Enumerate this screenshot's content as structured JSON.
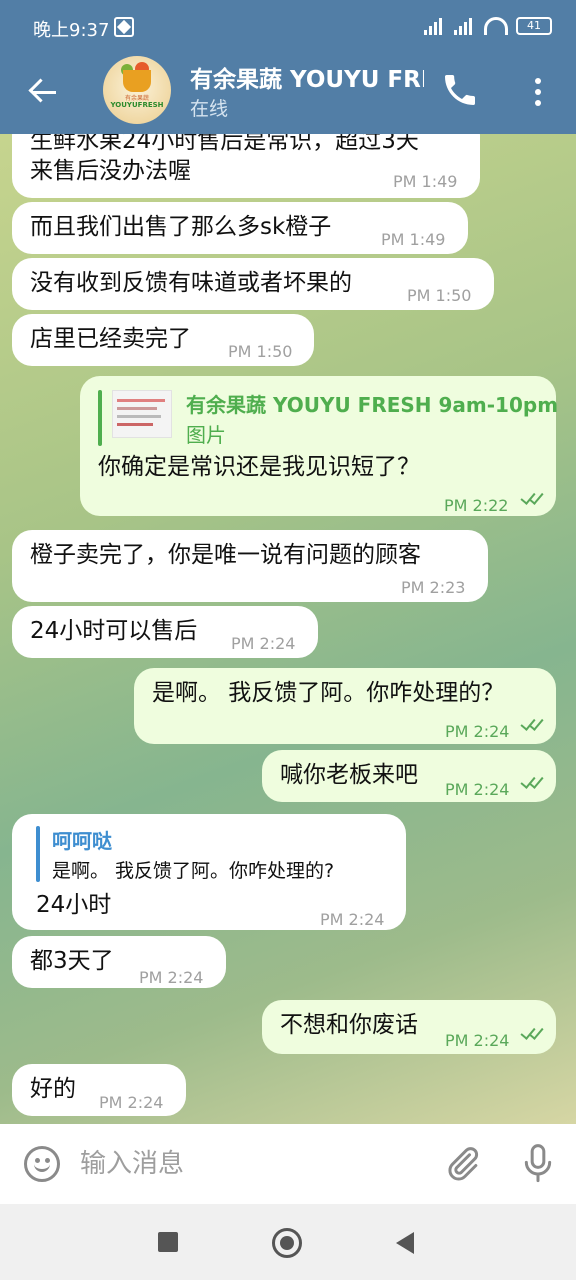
{
  "status_bar": {
    "time": "晚上9:37",
    "battery": "41"
  },
  "header": {
    "title": "有余果蔬 YOUYU FRESH",
    "subtitle": "在线",
    "avatar_small_text": "有余果蔬",
    "avatar_text": "YOUYUFRESH"
  },
  "messages": [
    {
      "dir": "in",
      "lines": [
        "生鲜水果24小时售后是常识，超过3天",
        "来售后没办法喔"
      ],
      "time": "PM 1:49"
    },
    {
      "dir": "in",
      "lines": [
        "而且我们出售了那么多sk橙子"
      ],
      "time": "PM 1:49"
    },
    {
      "dir": "in",
      "lines": [
        "没有收到反馈有味道或者坏果的"
      ],
      "time": "PM 1:50"
    },
    {
      "dir": "in",
      "lines": [
        "店里已经卖完了"
      ],
      "time": "PM 1:50"
    },
    {
      "dir": "out",
      "reply": {
        "name": "有余果蔬 YOUYU FRESH 9am-10pm",
        "text": "图片"
      },
      "lines": [
        "你确定是常识还是我见识短了？"
      ],
      "time": "PM 2:22"
    },
    {
      "dir": "in",
      "lines": [
        "橙子卖完了，你是唯一说有问题的顾客"
      ],
      "time": "PM 2:23"
    },
    {
      "dir": "in",
      "lines": [
        "24小时可以售后"
      ],
      "time": "PM 2:24"
    },
    {
      "dir": "out",
      "lines": [
        "是啊。 我反馈了阿。你咋处理的？"
      ],
      "time": "PM 2:24"
    },
    {
      "dir": "out",
      "lines": [
        "喊你老板来吧"
      ],
      "time": "PM 2:24"
    },
    {
      "dir": "in",
      "reply": {
        "name": "呵呵哒",
        "text": "是啊。 我反馈了阿。你咋处理的?"
      },
      "lines": [
        "24小时"
      ],
      "time": "PM 2:24"
    },
    {
      "dir": "in",
      "lines": [
        "都3天了"
      ],
      "time": "PM 2:24"
    },
    {
      "dir": "out",
      "lines": [
        "不想和你废话"
      ],
      "time": "PM 2:24"
    },
    {
      "dir": "in",
      "lines": [
        "好的"
      ],
      "time": "PM 2:24"
    }
  ],
  "composer": {
    "placeholder": "输入消息"
  },
  "icons": {
    "back": "arrow-left-icon",
    "call": "phone-icon",
    "menu": "more-vertical-icon",
    "emoji": "emoji-icon",
    "attach": "paperclip-icon",
    "voice": "microphone-icon",
    "read": "double-check-icon"
  },
  "colors": {
    "header": "#527ea6",
    "incoming_bubble": "#ffffff",
    "outgoing_bubble": "#effdde",
    "accent_green": "#4fae4e",
    "accent_blue": "#3e8ed0"
  }
}
